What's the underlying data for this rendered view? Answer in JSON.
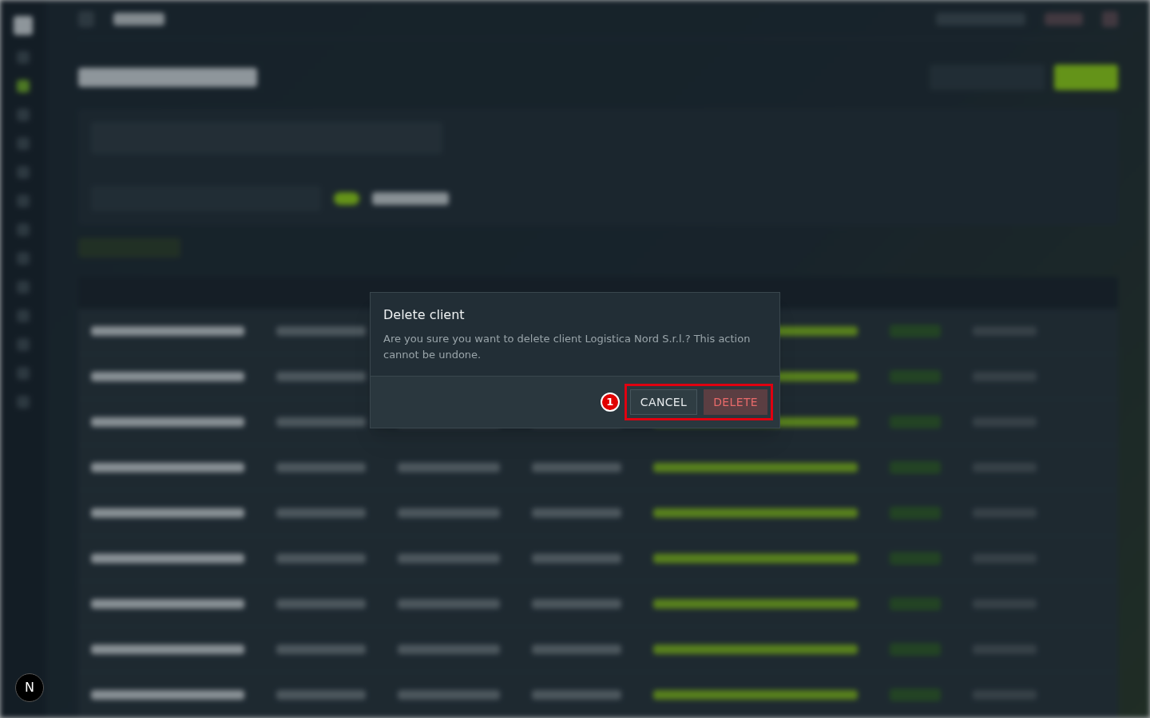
{
  "dialog": {
    "title": "Delete client",
    "message": "Are you sure you want to delete client Logistica Nord S.r.l.? This action cannot be undone.",
    "buttons": [
      {
        "label": "CANCEL",
        "kind": "secondary"
      },
      {
        "label": "DELETE",
        "kind": "danger"
      }
    ]
  },
  "annotation": {
    "marker": "1"
  },
  "dev_badge": {
    "label": "N"
  }
}
